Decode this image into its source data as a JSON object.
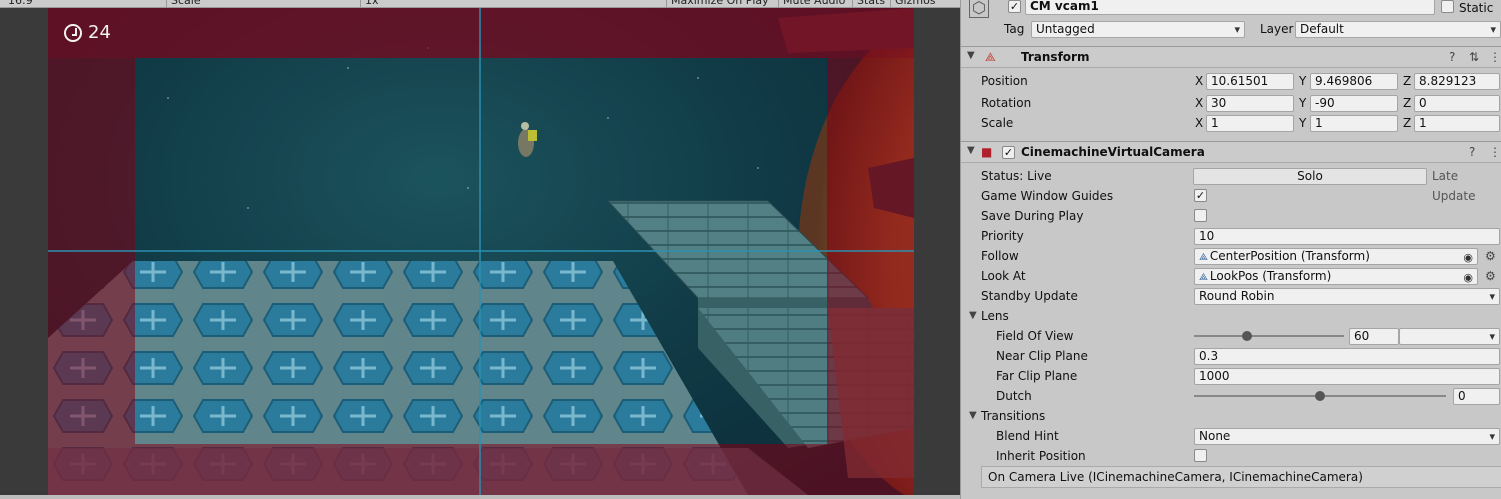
{
  "toolbar": {
    "display": "16:9",
    "scale": "Scale",
    "scale_value": "1x",
    "maximize": "Maximize On Play",
    "mute": "Mute Audio",
    "stats": "Stats",
    "gizmos": "Gizmos"
  },
  "game": {
    "fps": "24"
  },
  "object": {
    "name": "CM vcam1",
    "static_label": "Static",
    "tag_label": "Tag",
    "tag_value": "Untagged",
    "layer_label": "Layer",
    "layer_value": "Default"
  },
  "transform": {
    "title": "Transform",
    "position": {
      "label": "Position",
      "x": "10.61501",
      "y": "9.469806",
      "z": "8.829123"
    },
    "rotation": {
      "label": "Rotation",
      "x": "30",
      "y": "-90",
      "z": "0"
    },
    "scale": {
      "label": "Scale",
      "x": "1",
      "y": "1",
      "z": "1"
    },
    "axis_x": "X",
    "axis_y": "Y",
    "axis_z": "Z"
  },
  "vcam": {
    "title": "CinemachineVirtualCamera",
    "status": "Status: Live",
    "solo": "Solo",
    "late_update": "Late Update",
    "game_window_guides": {
      "label": "Game Window Guides",
      "checked": true
    },
    "save_during_play": {
      "label": "Save During Play",
      "checked": false
    },
    "priority": {
      "label": "Priority",
      "value": "10"
    },
    "follow": {
      "label": "Follow",
      "value": "CenterPosition (Transform)"
    },
    "look_at": {
      "label": "Look At",
      "value": "LookPos (Transform)"
    },
    "standby": {
      "label": "Standby Update",
      "value": "Round Robin"
    },
    "lens": {
      "label": "Lens",
      "fov": {
        "label": "Field Of View",
        "value": "60",
        "level": 0.35
      },
      "near": {
        "label": "Near Clip Plane",
        "value": "0.3"
      },
      "far": {
        "label": "Far Clip Plane",
        "value": "1000"
      },
      "dutch": {
        "label": "Dutch",
        "value": "0",
        "level": 0.5
      }
    },
    "transitions": {
      "label": "Transitions",
      "blend_hint": {
        "label": "Blend Hint",
        "value": "None"
      },
      "inherit_position": {
        "label": "Inherit Position",
        "checked": false
      },
      "on_camera_live": "On Camera Live (ICinemachineCamera, ICinemachineCamera)"
    }
  },
  "icons": {
    "help": "help-icon",
    "settings": "sliders-icon",
    "menu": "kebab-menu-icon",
    "clock": "clock-icon"
  },
  "colors": {
    "dead_zone": "#8b1a2e",
    "soft_zone": "#2a8fb0",
    "inspector_bg": "#c8c8c8"
  }
}
